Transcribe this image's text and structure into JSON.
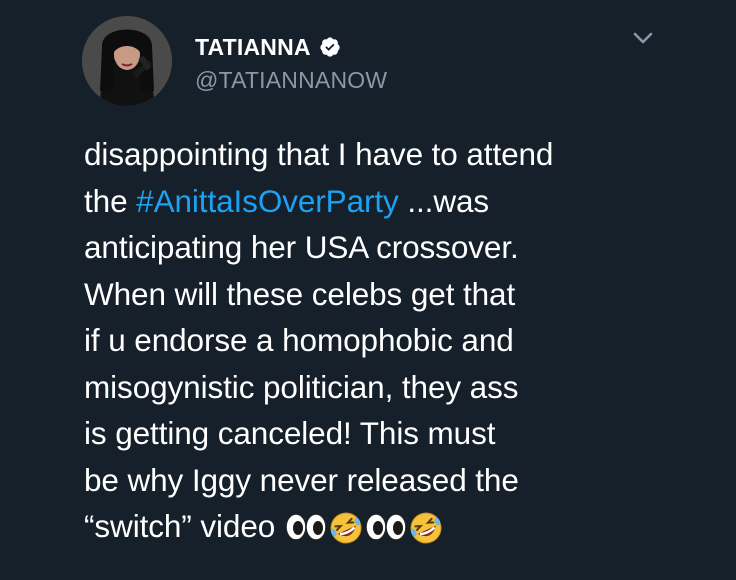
{
  "user": {
    "display_name": "TATIANNA",
    "handle": "@TATIANNANOW",
    "verified": true
  },
  "tweet": {
    "lines": [
      "disappointing that I have to attend",
      "the",
      "#AnittaIsOverParty",
      "...was",
      "anticipating her USA crossover.",
      "When will these celebs get that",
      "if u endorse a homophobic and",
      "misogynistic politician, they ass",
      "is getting canceled! This must",
      "be why Iggy never released the",
      "“switch” video"
    ],
    "emojis": [
      "eyes-emoji",
      "rofl-emoji",
      "eyes-emoji",
      "rofl-emoji"
    ]
  },
  "colors": {
    "background": "#15202b",
    "text": "#ffffff",
    "secondary": "#8899a6",
    "link": "#1da1f2",
    "verified_badge": "#ffffff"
  },
  "icons": {
    "verified": "verified-badge-icon",
    "menu": "chevron-down-icon"
  }
}
